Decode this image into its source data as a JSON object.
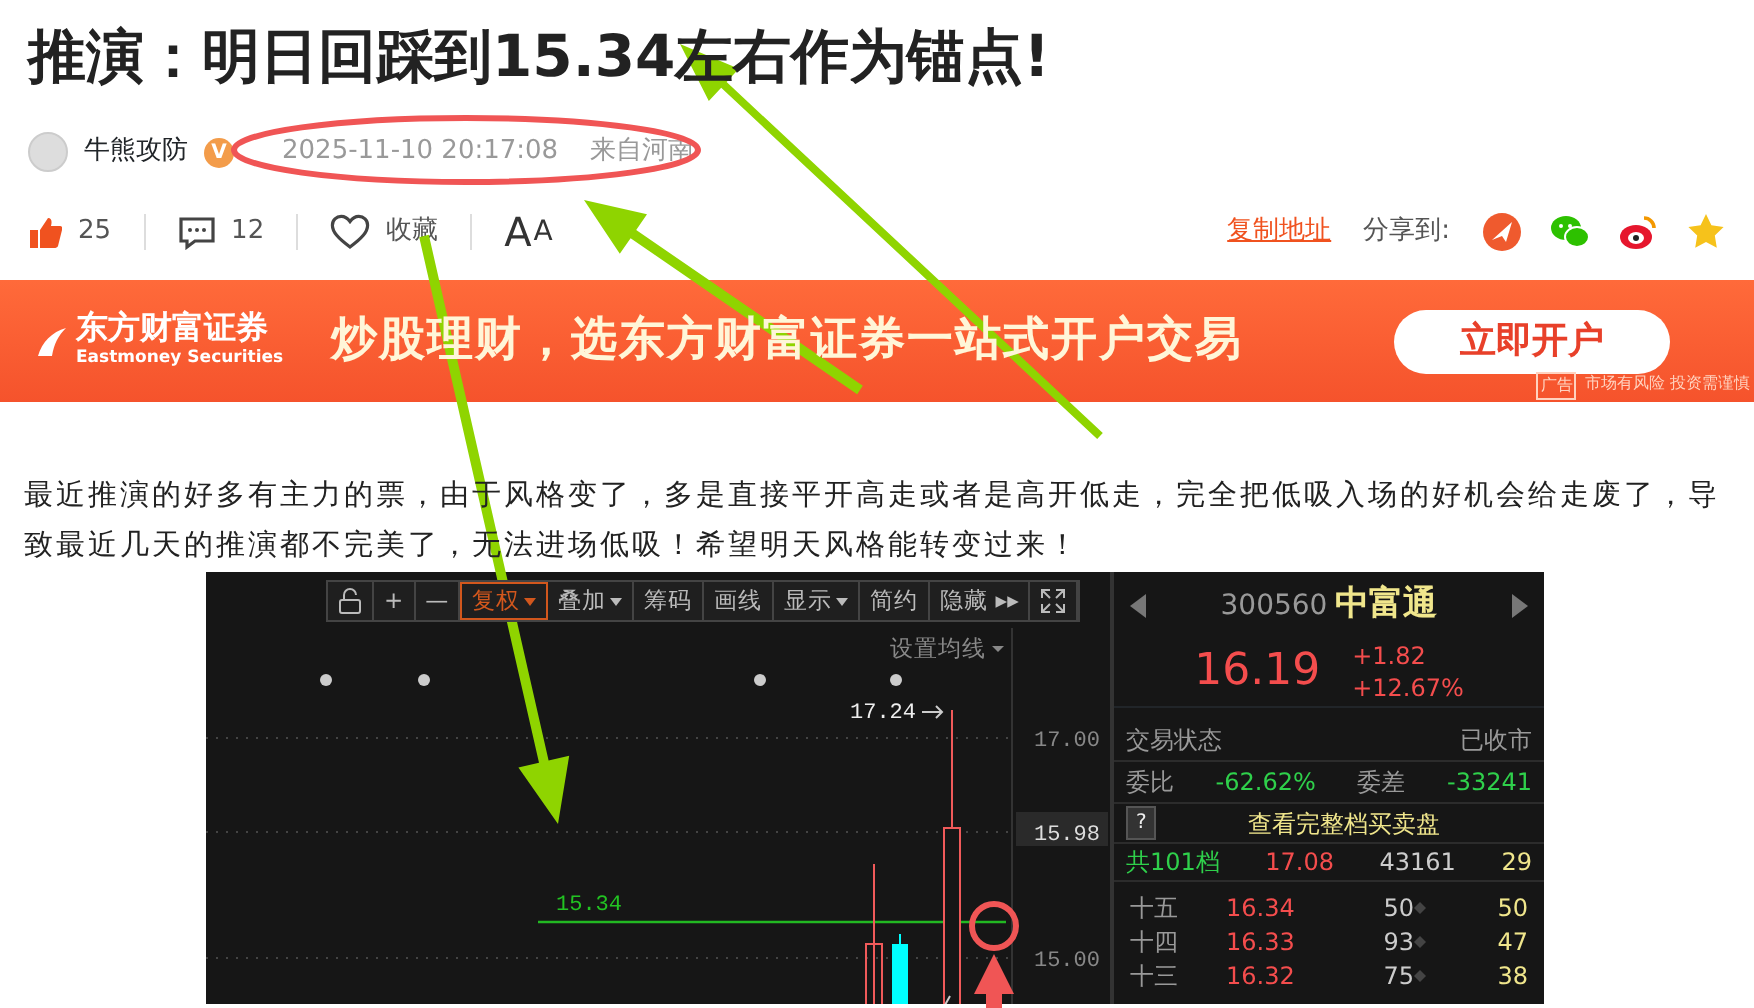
{
  "article": {
    "title": "推演：明日回踩到15.34左右作为锚点!"
  },
  "meta": {
    "author": "牛熊攻防",
    "verified_badge": "V",
    "date": "2025-11-10 20:17:08",
    "location": "来自河南"
  },
  "actions": {
    "likes": "25",
    "comments": "12",
    "favorite": "收藏",
    "font_large": "A",
    "font_small": "A",
    "copy_link": "复制地址",
    "share_label": "分享到:"
  },
  "banner": {
    "logo_name": "东方财富证券",
    "logo_sub": "Eastmoney Securities",
    "slogan": "炒股理财，选东方财富证券一站式开户交易",
    "button": "立即开户",
    "ad_tag": "广告",
    "disclaimer": "市场有风险 投资需谨慎"
  },
  "paragraph": "最近推演的好多有主力的票，由于风格变了，多是直接平开高走或者是高开低走，完全把低吸入场的好机会给走废了，导致最近几天的推演都不完美了，无法进场低吸！希望明天风格能转变过来！",
  "chart_screenshot": {
    "toolbar": [
      {
        "kind": "icon",
        "selected": false
      },
      {
        "kind": "text",
        "label": "+",
        "dropdown": false,
        "selected": false
      },
      {
        "kind": "text",
        "label": "—",
        "dropdown": false,
        "selected": false
      },
      {
        "kind": "text",
        "label": "复权",
        "dropdown": true,
        "selected": true
      },
      {
        "kind": "text",
        "label": "叠加",
        "dropdown": true,
        "selected": false
      },
      {
        "kind": "text",
        "label": "筹码",
        "dropdown": false,
        "selected": false
      },
      {
        "kind": "text",
        "label": "画线",
        "dropdown": false,
        "selected": false
      },
      {
        "kind": "text",
        "label": "显示",
        "dropdown": true,
        "selected": false
      },
      {
        "kind": "text",
        "label": "简约",
        "dropdown": false,
        "selected": false
      },
      {
        "kind": "text",
        "label": "隐藏 ▸▸",
        "dropdown": false,
        "selected": false
      },
      {
        "kind": "icon",
        "selected": false
      }
    ],
    "ma_setting": "设置均线",
    "high_label": "17.24",
    "anchor_label": "15.34",
    "axis_labels": [
      {
        "text": "17.00",
        "current": false
      },
      {
        "text": "15.98",
        "current": true
      },
      {
        "text": "15.00",
        "current": false
      }
    ]
  },
  "quote": {
    "code": "300560",
    "name": "中富通",
    "price": "16.19",
    "change": "+1.82",
    "change_pct": "+12.67%",
    "status_label": "交易状态",
    "status": "已收市",
    "ratio_label": "委比",
    "ratio": "-62.62%",
    "diff_label": "委差",
    "diff": "-33241",
    "help": "?",
    "full_book": "查看完整档买卖盘",
    "total_label": "共101档",
    "total_price": "17.08",
    "total_volume": "43161",
    "total_count": "29",
    "levels": [
      {
        "label": "十五",
        "price": "16.34",
        "volume": "50",
        "count": "50"
      },
      {
        "label": "十四",
        "price": "16.33",
        "volume": "93",
        "count": "47"
      },
      {
        "label": "十三",
        "price": "16.32",
        "volume": "75",
        "count": "38"
      }
    ]
  }
}
